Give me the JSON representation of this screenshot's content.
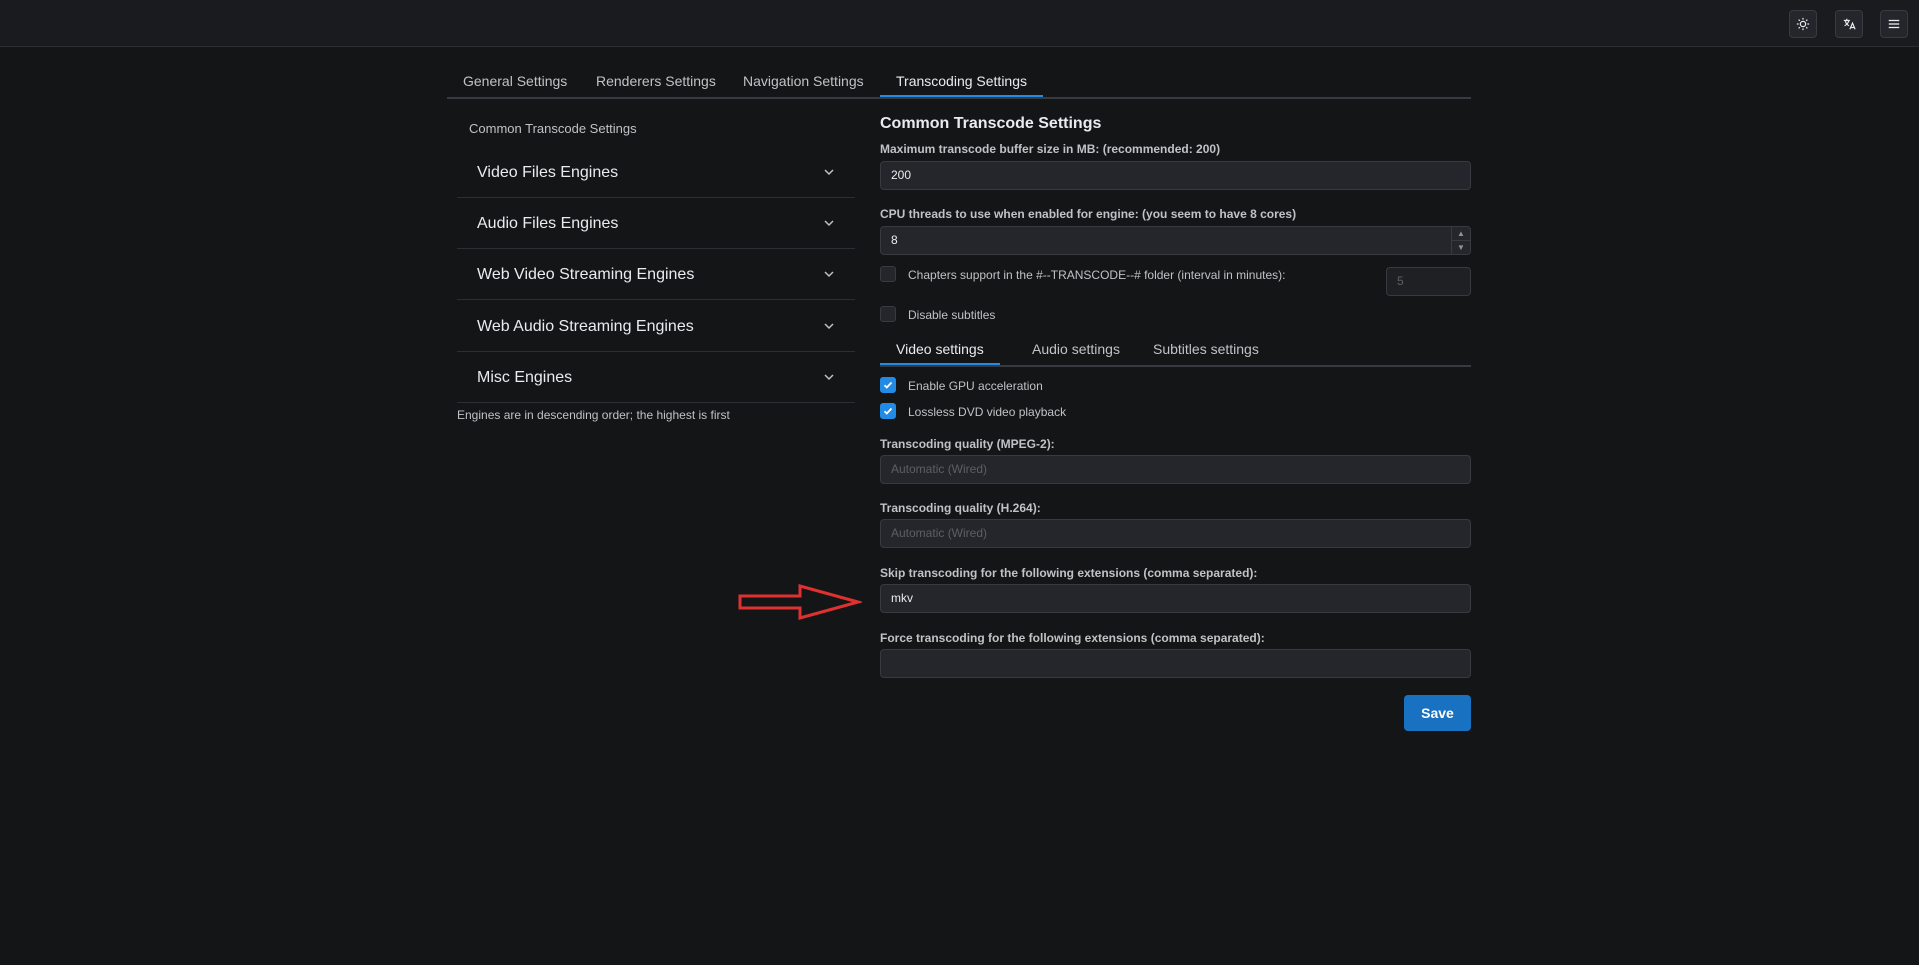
{
  "topbar": {
    "buttons": [
      {
        "icon": "sun-icon"
      },
      {
        "icon": "language-icon"
      },
      {
        "icon": "menu-icon"
      }
    ]
  },
  "tabs": [
    {
      "label": "General Settings",
      "active": false
    },
    {
      "label": "Renderers Settings",
      "active": false
    },
    {
      "label": "Navigation Settings",
      "active": false
    },
    {
      "label": "Transcoding Settings",
      "active": true
    }
  ],
  "left": {
    "header": "Common Transcode Settings",
    "engines": [
      "Video Files Engines",
      "Audio Files Engines",
      "Web Video Streaming Engines",
      "Web Audio Streaming Engines",
      "Misc Engines"
    ],
    "note": "Engines are in descending order; the highest is first"
  },
  "right": {
    "title": "Common Transcode Settings",
    "buffer_label": "Maximum transcode buffer size in MB: (recommended: 200)",
    "buffer_value": "200",
    "threads_label": "CPU threads to use when enabled for engine: (you seem to have 8 cores)",
    "threads_value": "8",
    "chapters_label": "Chapters support in the #--TRANSCODE--# folder (interval in minutes):",
    "chapters_checked": false,
    "chapters_interval": "5",
    "disable_subtitles_label": "Disable subtitles",
    "disable_subtitles_checked": false,
    "subtabs": [
      {
        "label": "Video settings",
        "active": true
      },
      {
        "label": "Audio settings",
        "active": false
      },
      {
        "label": "Subtitles settings",
        "active": false
      }
    ],
    "gpu_label": "Enable GPU acceleration",
    "gpu_checked": true,
    "dvd_label": "Lossless DVD video playback",
    "dvd_checked": true,
    "mpeg2_label": "Transcoding quality (MPEG-2):",
    "mpeg2_placeholder": "Automatic (Wired)",
    "h264_label": "Transcoding quality (H.264):",
    "h264_placeholder": "Automatic (Wired)",
    "skip_label": "Skip transcoding for the following extensions (comma separated):",
    "skip_value": "mkv",
    "force_label": "Force transcoding for the following extensions (comma separated):",
    "force_value": "",
    "save_label": "Save"
  },
  "colors": {
    "accent": "#228be6",
    "save_button": "#1971c2",
    "annotation_arrow": "#e03131",
    "background": "#141517"
  }
}
